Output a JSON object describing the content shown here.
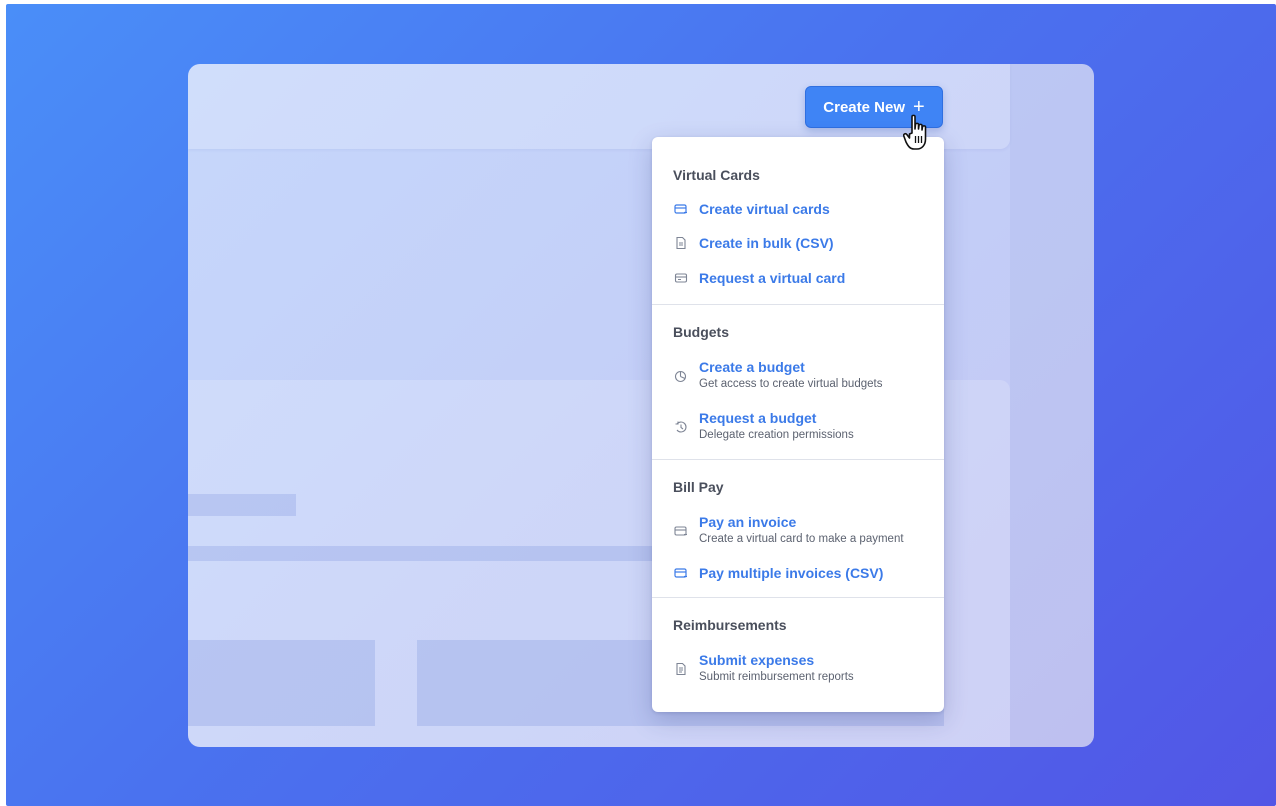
{
  "header": {
    "create_button_label": "Create New",
    "create_button_icon": "plus-icon",
    "accent": "#3f84f5"
  },
  "menu": {
    "sections": [
      {
        "title": "Virtual Cards",
        "items": [
          {
            "label": "Create virtual cards",
            "icon": "card-icon"
          },
          {
            "label": "Create in bulk (CSV)",
            "icon": "document-icon"
          },
          {
            "label": "Request a virtual card",
            "icon": "card-request-icon"
          }
        ]
      },
      {
        "title": "Budgets",
        "items": [
          {
            "label": "Create a budget",
            "sub": "Get access to create virtual budgets",
            "icon": "pie-chart-icon"
          },
          {
            "label": "Request a budget",
            "sub": "Delegate creation permissions",
            "icon": "budget-request-icon"
          }
        ]
      },
      {
        "title": "Bill Pay",
        "items": [
          {
            "label": "Pay an invoice",
            "sub": "Create a virtual card to make a payment",
            "icon": "card-icon"
          },
          {
            "label": "Pay multiple invoices (CSV)",
            "icon": "card-icon"
          }
        ]
      },
      {
        "title": "Reimbursements",
        "items": [
          {
            "label": "Submit expenses",
            "sub": "Submit reimbursement reports",
            "icon": "receipt-icon"
          }
        ]
      }
    ]
  },
  "colors": {
    "link": "#3b7ae8",
    "heading": "#4a4f5c",
    "subtext": "#5c6270"
  }
}
